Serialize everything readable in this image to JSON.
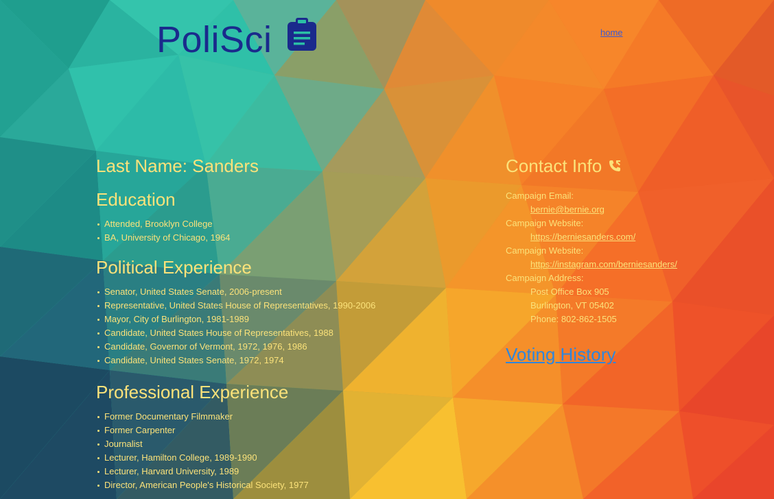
{
  "header": {
    "logo_text": "PoliSci",
    "logo_icon": "clipboard-icon",
    "home_link": "home"
  },
  "profile": {
    "name_heading": "Last Name: Sanders",
    "education": {
      "title": "Education",
      "items": [
        "Attended, Brooklyn College",
        "BA, University of Chicago, 1964"
      ]
    },
    "political": {
      "title": "Political Experience",
      "items": [
        "Senator, United States Senate, 2006-present",
        "Representative, United States House of Representatives, 1990-2006",
        "Mayor, City of Burlington, 1981-1989",
        "Candidate, United States House of Representatives, 1988",
        "Candidate, Governor of Vermont, 1972, 1976, 1986",
        "Candidate, United States Senate, 1972, 1974"
      ]
    },
    "professional": {
      "title": "Professional Experience",
      "items": [
        "Former Documentary Filmmaker",
        "Former Carpenter",
        "Journalist",
        "Lecturer, Hamilton College, 1989-1990",
        "Lecturer, Harvard University, 1989",
        "Director, American People's Historical Society, 1977"
      ]
    }
  },
  "contact": {
    "title": "Contact Info",
    "icon": "phone-icon",
    "email_label": "Campaign Email:",
    "email": "bernie@bernie.org",
    "website_label": "Campaign Website:",
    "website": "https://berniesanders.com/",
    "website2_label": "Campaign Website:",
    "website2": "https://instagram.com/berniesanders/",
    "address_label": "Campaign Address:",
    "address_line1": "Post Office Box 905",
    "address_line2": "Burlington, VT 05402",
    "phone": "Phone: 802-862-1505",
    "voting_link": "Voting History"
  },
  "colors": {
    "logo": "#1a2a8c",
    "text": "#fbe27a",
    "voting_link": "#2f86dc",
    "home_link": "#3b5ad6"
  }
}
